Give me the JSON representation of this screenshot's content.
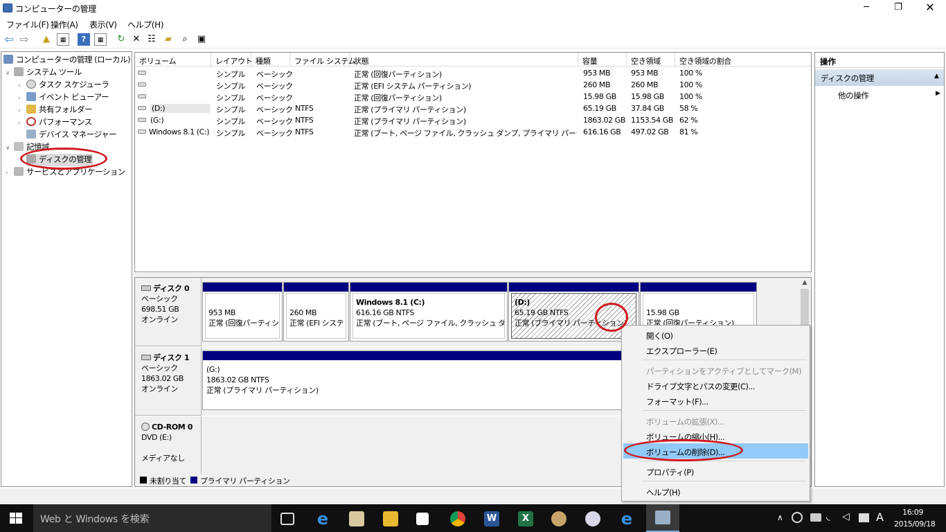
{
  "window": {
    "title": "コンピューターの管理"
  },
  "menu": [
    "ファイル(F)",
    "操作(A)",
    "表示(V)",
    "ヘルプ(H)"
  ],
  "tree": {
    "root": "コンピューターの管理 (ローカル)",
    "system_tools": "システム ツール",
    "task_scheduler": "タスク スケジューラ",
    "event_viewer": "イベント ビューアー",
    "shared_folders": "共有フォルダー",
    "performance": "パフォーマンス",
    "device_manager": "デバイス マネージャー",
    "storage": "記憶域",
    "disk_management": "ディスクの管理",
    "services_apps": "サービスとアプリケーション"
  },
  "volumes": {
    "headers": [
      "ボリューム",
      "レイアウト",
      "種類",
      "ファイル システム",
      "状態",
      "容量",
      "空き領域",
      "空き領域の割合"
    ],
    "rows": [
      [
        "",
        "シンプル",
        "ベーシック",
        "",
        "正常 (回復パーティション)",
        "953 MB",
        "953 MB",
        "100 %"
      ],
      [
        "",
        "シンプル",
        "ベーシック",
        "",
        "正常 (EFI システム パーティション)",
        "260 MB",
        "260 MB",
        "100 %"
      ],
      [
        "",
        "シンプル",
        "ベーシック",
        "",
        "正常 (回復パーティション)",
        "15.98 GB",
        "15.98 GB",
        "100 %"
      ],
      [
        "(D:)",
        "シンプル",
        "ベーシック",
        "NTFS",
        "正常 (プライマリ パーティション)",
        "65.19 GB",
        "37.84 GB",
        "58 %"
      ],
      [
        "(G:)",
        "シンプル",
        "ベーシック",
        "NTFS",
        "正常 (プライマリ パーティション)",
        "1863.02 GB",
        "1153.54 GB",
        "62 %"
      ],
      [
        "Windows 8.1 (C:)",
        "シンプル",
        "ベーシック",
        "NTFS",
        "正常 (ブート, ページ ファイル, クラッシュ ダンプ, プライマリ パーティション)",
        "616.16 GB",
        "497.02 GB",
        "81 %"
      ]
    ]
  },
  "disks": {
    "disk0": {
      "name": "ディスク 0",
      "type": "ベーシック",
      "size": "698.51 GB",
      "status": "オンライン"
    },
    "disk1": {
      "name": "ディスク 1",
      "type": "ベーシック",
      "size": "1863.02 GB",
      "status": "オンライン"
    },
    "cdrom0": {
      "name": "CD-ROM 0",
      "type": "DVD (E:)",
      "status": "メディアなし"
    },
    "d0p1": {
      "size": "953 MB",
      "status": "正常 (回復パーティシ:"
    },
    "d0p2": {
      "size": "260 MB",
      "status": "正常 (EFI システ"
    },
    "d0p3": {
      "name": "Windows 8.1  (C:)",
      "size": "616.16 GB NTFS",
      "status": "正常 (ブート, ページ ファイル, クラッシュ ダンプ, ブ"
    },
    "d0p4": {
      "name": "(D:)",
      "size": "65.19 GB NTFS",
      "status": "正常 (プライマリ パーティション)"
    },
    "d0p5": {
      "size": "15.98 GB",
      "status": "正常 (回復パーティション)"
    },
    "d1p1": {
      "name": "(G:)",
      "size": "1863.02 GB NTFS",
      "status": "正常 (プライマリ パーティション)"
    }
  },
  "legend": {
    "unallocated": "未割り当て",
    "primary": "プライマリ パーティション"
  },
  "actions": {
    "header": "操作",
    "section": "ディスクの管理",
    "more": "他の操作"
  },
  "context_menu": {
    "open": "開く(O)",
    "explorer": "エクスプローラー(E)",
    "mark_active": "パーティションをアクティブとしてマーク(M)",
    "change_letter": "ドライブ文字とパスの変更(C)...",
    "format": "フォーマット(F)...",
    "extend": "ボリュームの拡張(X)...",
    "shrink": "ボリュームの縮小(H)...",
    "delete": "ボリュームの削除(D)...",
    "properties": "プロパティ(P)",
    "help": "ヘルプ(H)"
  },
  "taskbar": {
    "search_placeholder": "Web と Windows を検索",
    "ime": "A",
    "time": "16:09",
    "date": "2015/09/18"
  },
  "colors": {
    "primary_partition": "#000080",
    "highlight": "#91c9f7",
    "annotation": "#d01820",
    "taskbar": "#101010"
  }
}
